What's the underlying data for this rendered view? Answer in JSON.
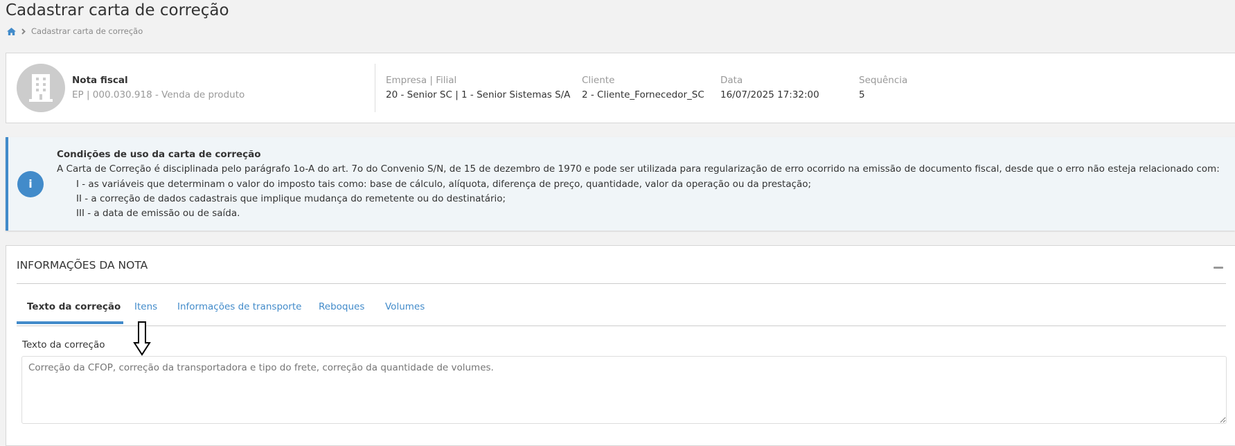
{
  "page": {
    "title": "Cadastrar carta de correção"
  },
  "breadcrumb": {
    "items": [
      "Cadastrar carta de correção"
    ]
  },
  "header": {
    "title": "Nota fiscal",
    "subtitle": "EP | 000.030.918 - Venda de produto",
    "fields": [
      {
        "label": "Empresa | Filial",
        "value": "20 - Senior SC | 1 - Senior Sistemas S/A"
      },
      {
        "label": "Cliente",
        "value": "2 - Cliente_Fornecedor_SC"
      },
      {
        "label": "Data",
        "value": "16/07/2025 17:32:00"
      },
      {
        "label": "Sequência",
        "value": "5"
      }
    ]
  },
  "notice": {
    "title": "Condições de uso da carta de correção",
    "intro": "A Carta de Correção é disciplinada pelo parágrafo 1o-A do art. 7o do Convenio S/N, de 15 de dezembro de 1970 e pode ser utilizada para regularização de erro ocorrido na emissão de documento fiscal, desde que o erro não esteja relacionado com:",
    "items": [
      "I - as variáveis que determinam o valor do imposto tais como: base de cálculo, alíquota, diferença de preço, quantidade, valor da operação ou da prestação;",
      "II - a correção de dados cadastrais que implique mudança do remetente ou do destinatário;",
      "III - a data de emissão ou de saída."
    ]
  },
  "panel": {
    "title": "INFORMAÇÕES DA NOTA",
    "tabs": [
      "Texto da correção",
      "Itens",
      "Informações de transporte",
      "Reboques",
      "Volumes"
    ],
    "field_label": "Texto da correção",
    "field_placeholder": "Correção da CFOP, correção da transportadora e tipo do frete, correção da quantidade de volumes."
  },
  "colors": {
    "accent": "#428bca",
    "background": "#f2f2f2",
    "notice_bg": "#f0f5f8"
  }
}
